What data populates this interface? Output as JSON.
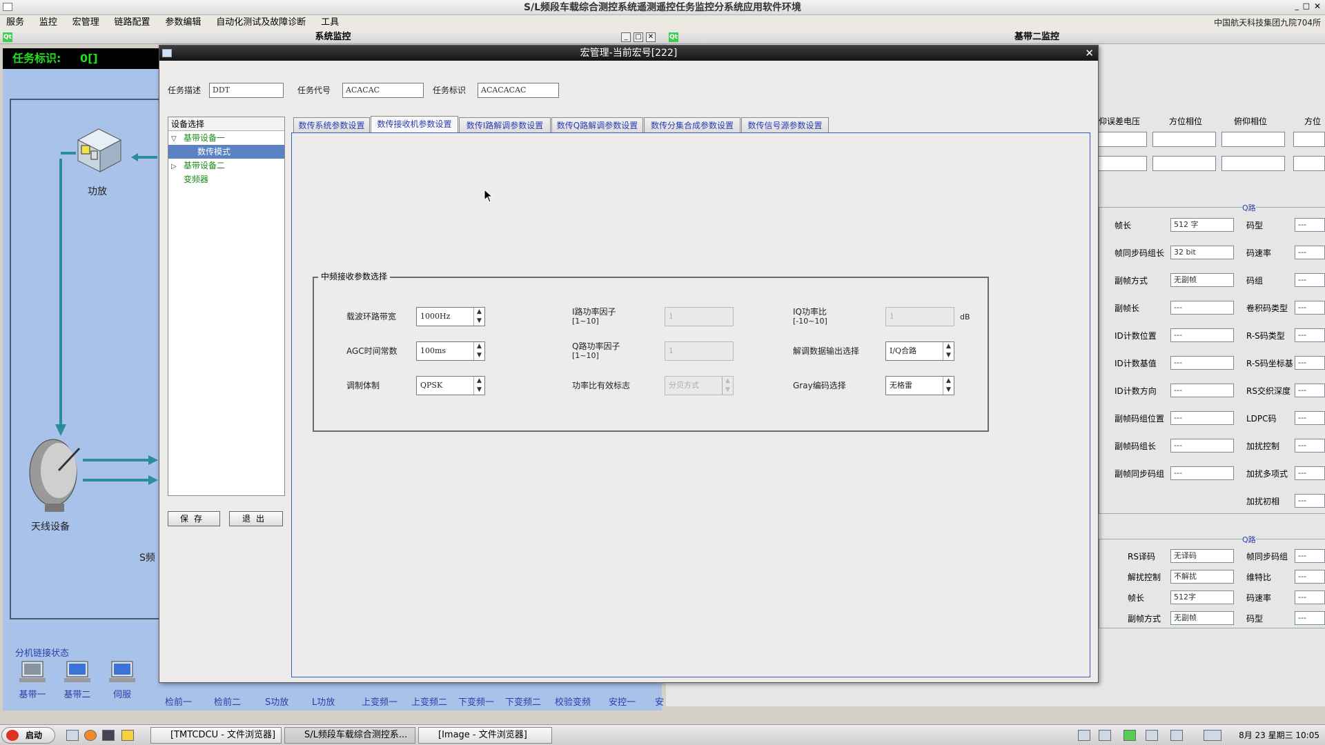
{
  "app": {
    "title": "S/L频段车载综合测控系统遥测遥控任务监控分系统应用软件环境",
    "org": "中国航天科技集团九院704所",
    "menu": [
      "服务",
      "监控",
      "宏管理",
      "链路配置",
      "参数编辑",
      "自动化测试及故障诊断",
      "工具"
    ],
    "window_controls": [
      "_",
      "□",
      "✕"
    ]
  },
  "left_window": {
    "title": "系统监控",
    "task_label": "任务标识:",
    "task_value": "0[]",
    "devices": {
      "amp": "功放",
      "antenna": "天线设备",
      "s_partial": "S频"
    },
    "link_status_title": "分机链接状态",
    "link_items": [
      "基带一",
      "基带二",
      "伺服",
      "检前一",
      "检前二",
      "S功放",
      "L功放",
      "上变频一",
      "上变频二",
      "下变频一",
      "下变频二",
      "校验变频",
      "安控一",
      "安"
    ]
  },
  "right_window": {
    "title": "基带二监控",
    "top_headers": [
      "仰误差电压",
      "方位相位",
      "俯仰相位",
      "方位"
    ],
    "q_group_label": "Q路",
    "rows1": [
      {
        "label": "帧长",
        "value": "512 字",
        "label2": "码型",
        "value2": "---"
      },
      {
        "label": "帧同步码组长",
        "value": "32 bit",
        "label2": "码速率",
        "value2": "---"
      },
      {
        "label": "副帧方式",
        "value": "无副帧",
        "label2": "码组",
        "value2": "---"
      },
      {
        "label": "副帧长",
        "value": "---",
        "label2": "卷积码类型",
        "value2": "---"
      },
      {
        "label": "ID计数位置",
        "value": "---",
        "label2": "R-S码类型",
        "value2": "---"
      },
      {
        "label": "ID计数基值",
        "value": "---",
        "label2": "R-S码坐标基",
        "value2": "---"
      },
      {
        "label": "ID计数方向",
        "value": "---",
        "label2": "RS交织深度",
        "value2": "---"
      },
      {
        "label": "副帧码组位置",
        "value": "---",
        "label2": "LDPC码",
        "value2": "---"
      },
      {
        "label": "副帧码组长",
        "value": "---",
        "label2": "加扰控制",
        "value2": "---"
      },
      {
        "label": "副帧同步码组",
        "value": "---",
        "label2": "加扰多项式",
        "value2": "---"
      },
      {
        "label": "",
        "value": "",
        "label2": "加扰初相",
        "value2": "---"
      }
    ],
    "rows2": [
      {
        "label": "RS译码",
        "value": "无译码",
        "label2": "帧同步码组",
        "value2": "---"
      },
      {
        "label": "解扰控制",
        "value": "不解扰",
        "label2": "维特比",
        "value2": "---"
      },
      {
        "label": "帧长",
        "value": "512字",
        "label2": "码速率",
        "value2": "---"
      },
      {
        "label": "副帧方式",
        "value": "无副帧",
        "label2": "码型",
        "value2": "---"
      }
    ]
  },
  "dialog": {
    "title": "宏管理-当前宏号[222]",
    "close": "✕",
    "task_desc_label": "任务描述",
    "task_desc_value": "DDT",
    "task_code_label": "任务代号",
    "task_code_value": "ACACAC",
    "task_id_label": "任务标识",
    "task_id_value": "ACACACAC",
    "device_select": "设备选择",
    "tree": [
      {
        "label": "基带设备一",
        "expander": "▽"
      },
      {
        "label": "数传模式",
        "expander": ""
      },
      {
        "label": "基带设备二",
        "expander": "▷"
      },
      {
        "label": "变频器",
        "expander": ""
      }
    ],
    "save": "保存",
    "exit": "退出",
    "tabs": [
      "数传系统参数设置",
      "数传接收机参数设置",
      "数传I路解调参数设置",
      "数传Q路解调参数设置",
      "数传分集合成参数设置",
      "数传信号源参数设置"
    ],
    "group_title": "中频接收参数选择",
    "params": {
      "carrier_bw_label": "载波环路带宽",
      "carrier_bw_value": "1000Hz",
      "agc_label": "AGC时间常数",
      "agc_value": "100ms",
      "mod_label": "调制体制",
      "mod_value": "QPSK",
      "i_power_label": "I路功率因子",
      "i_power_range": "[1~10]",
      "i_power_value": "1",
      "q_power_label": "Q路功率因子",
      "q_power_range": "[1~10]",
      "q_power_value": "1",
      "power_valid_label": "功率比有效标志",
      "power_valid_value": "分贝方式",
      "iq_ratio_label": "IQ功率比",
      "iq_ratio_range": "[-10~10]",
      "iq_ratio_value": "1",
      "iq_ratio_unit": "dB",
      "demod_out_label": "解调数据输出选择",
      "demod_out_value": "I/Q合路",
      "gray_label": "Gray编码选择",
      "gray_value": "无格雷"
    }
  },
  "taskbar": {
    "start": "启动",
    "tasks": [
      "[TMTCDCU - 文件浏览器]",
      "S/L频段车载综合测控系...",
      "[Image - 文件浏览器]"
    ],
    "clock": "8月 23 星期三 10:05"
  },
  "colors": {
    "dialog_title_bg": "#1f1f1f",
    "tab_text": "#2a3cb0",
    "tree_select": "#5b82c2",
    "task_id_green": "#1fe01f",
    "diagram_bg": "#a9c2ea"
  }
}
